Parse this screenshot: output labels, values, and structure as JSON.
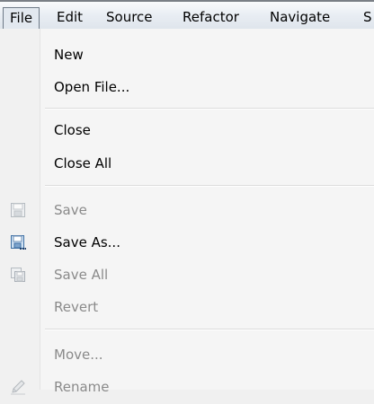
{
  "menubar": {
    "items": [
      {
        "label": "File"
      },
      {
        "label": "Edit"
      },
      {
        "label": "Source"
      },
      {
        "label": "Refactor"
      },
      {
        "label": "Navigate"
      },
      {
        "label": "S"
      }
    ]
  },
  "file_menu": {
    "new": "New",
    "open_file": "Open File...",
    "close": "Close",
    "close_all": "Close All",
    "save": "Save",
    "save_as": "Save As...",
    "save_all": "Save All",
    "revert": "Revert",
    "move": "Move...",
    "rename": "Rename"
  },
  "icons": {
    "save": "save-icon",
    "save_as": "save-as-icon",
    "save_all": "save-all-icon",
    "rename": "rename-icon"
  }
}
